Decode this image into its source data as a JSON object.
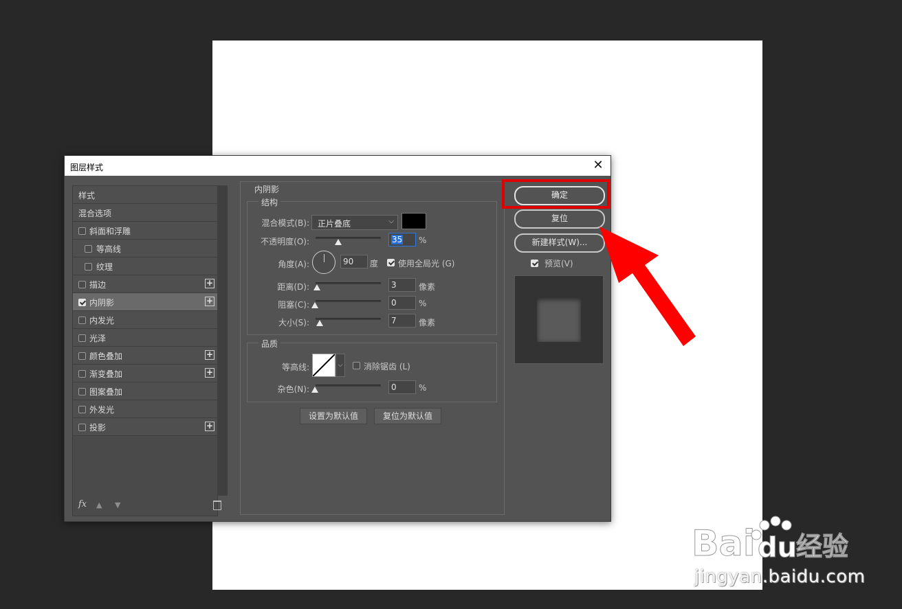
{
  "dialog": {
    "title": "图层样式",
    "close_glyph": "✕"
  },
  "styles_list": [
    {
      "label": "样式"
    },
    {
      "label": "混合选项"
    },
    {
      "label": "斜面和浮雕",
      "checked": false
    },
    {
      "label": "等高线",
      "checked": false
    },
    {
      "label": "纹理",
      "checked": false
    },
    {
      "label": "描边",
      "checked": false,
      "plus": true
    },
    {
      "label": "内阴影",
      "checked": true,
      "plus": true,
      "active": true
    },
    {
      "label": "内发光",
      "checked": false
    },
    {
      "label": "光泽",
      "checked": false
    },
    {
      "label": "颜色叠加",
      "checked": false,
      "plus": true
    },
    {
      "label": "渐变叠加",
      "checked": false,
      "plus": true
    },
    {
      "label": "图案叠加",
      "checked": false
    },
    {
      "label": "外发光",
      "checked": false
    },
    {
      "label": "投影",
      "checked": false,
      "plus": true
    }
  ],
  "left_footer": {
    "fx": "fx",
    "icons": [
      "move-up-icon",
      "move-down-icon",
      "trash-icon"
    ]
  },
  "inner_shadow": {
    "section_title": "内阴影",
    "structure": {
      "title": "结构",
      "blend_mode_label": "混合模式(B):",
      "blend_mode_value": "正片叠底",
      "shadow_color": "#000000",
      "opacity_label": "不透明度(O):",
      "opacity_value": "35",
      "opacity_unit": "%",
      "angle_label": "角度(A):",
      "angle_value": "90",
      "angle_unit": "度",
      "global_light_label": "使用全局光 (G)",
      "global_light_checked": true,
      "distance_label": "距离(D):",
      "distance_value": "3",
      "distance_unit": "像素",
      "choke_label": "阻塞(C):",
      "choke_value": "0",
      "choke_unit": "%",
      "size_label": "大小(S):",
      "size_value": "7",
      "size_unit": "像素"
    },
    "quality": {
      "title": "品质",
      "contour_label": "等高线:",
      "anti_alias_label": "消除锯齿 (L)",
      "anti_alias_checked": false,
      "noise_label": "杂色(N):",
      "noise_value": "0",
      "noise_unit": "%"
    },
    "make_default_label": "设置为默认值",
    "reset_default_label": "复位为默认值"
  },
  "buttons": {
    "ok": "确定",
    "reset": "复位",
    "new_style": "新建样式(W)...",
    "preview_label": "预览(V)",
    "preview_checked": true
  },
  "annotation": {
    "highlight_color": "#e10000",
    "arrow_color": "#ff0000"
  },
  "watermark": {
    "logo": "Bai du 经验",
    "url": "jingyan.baidu.com"
  }
}
